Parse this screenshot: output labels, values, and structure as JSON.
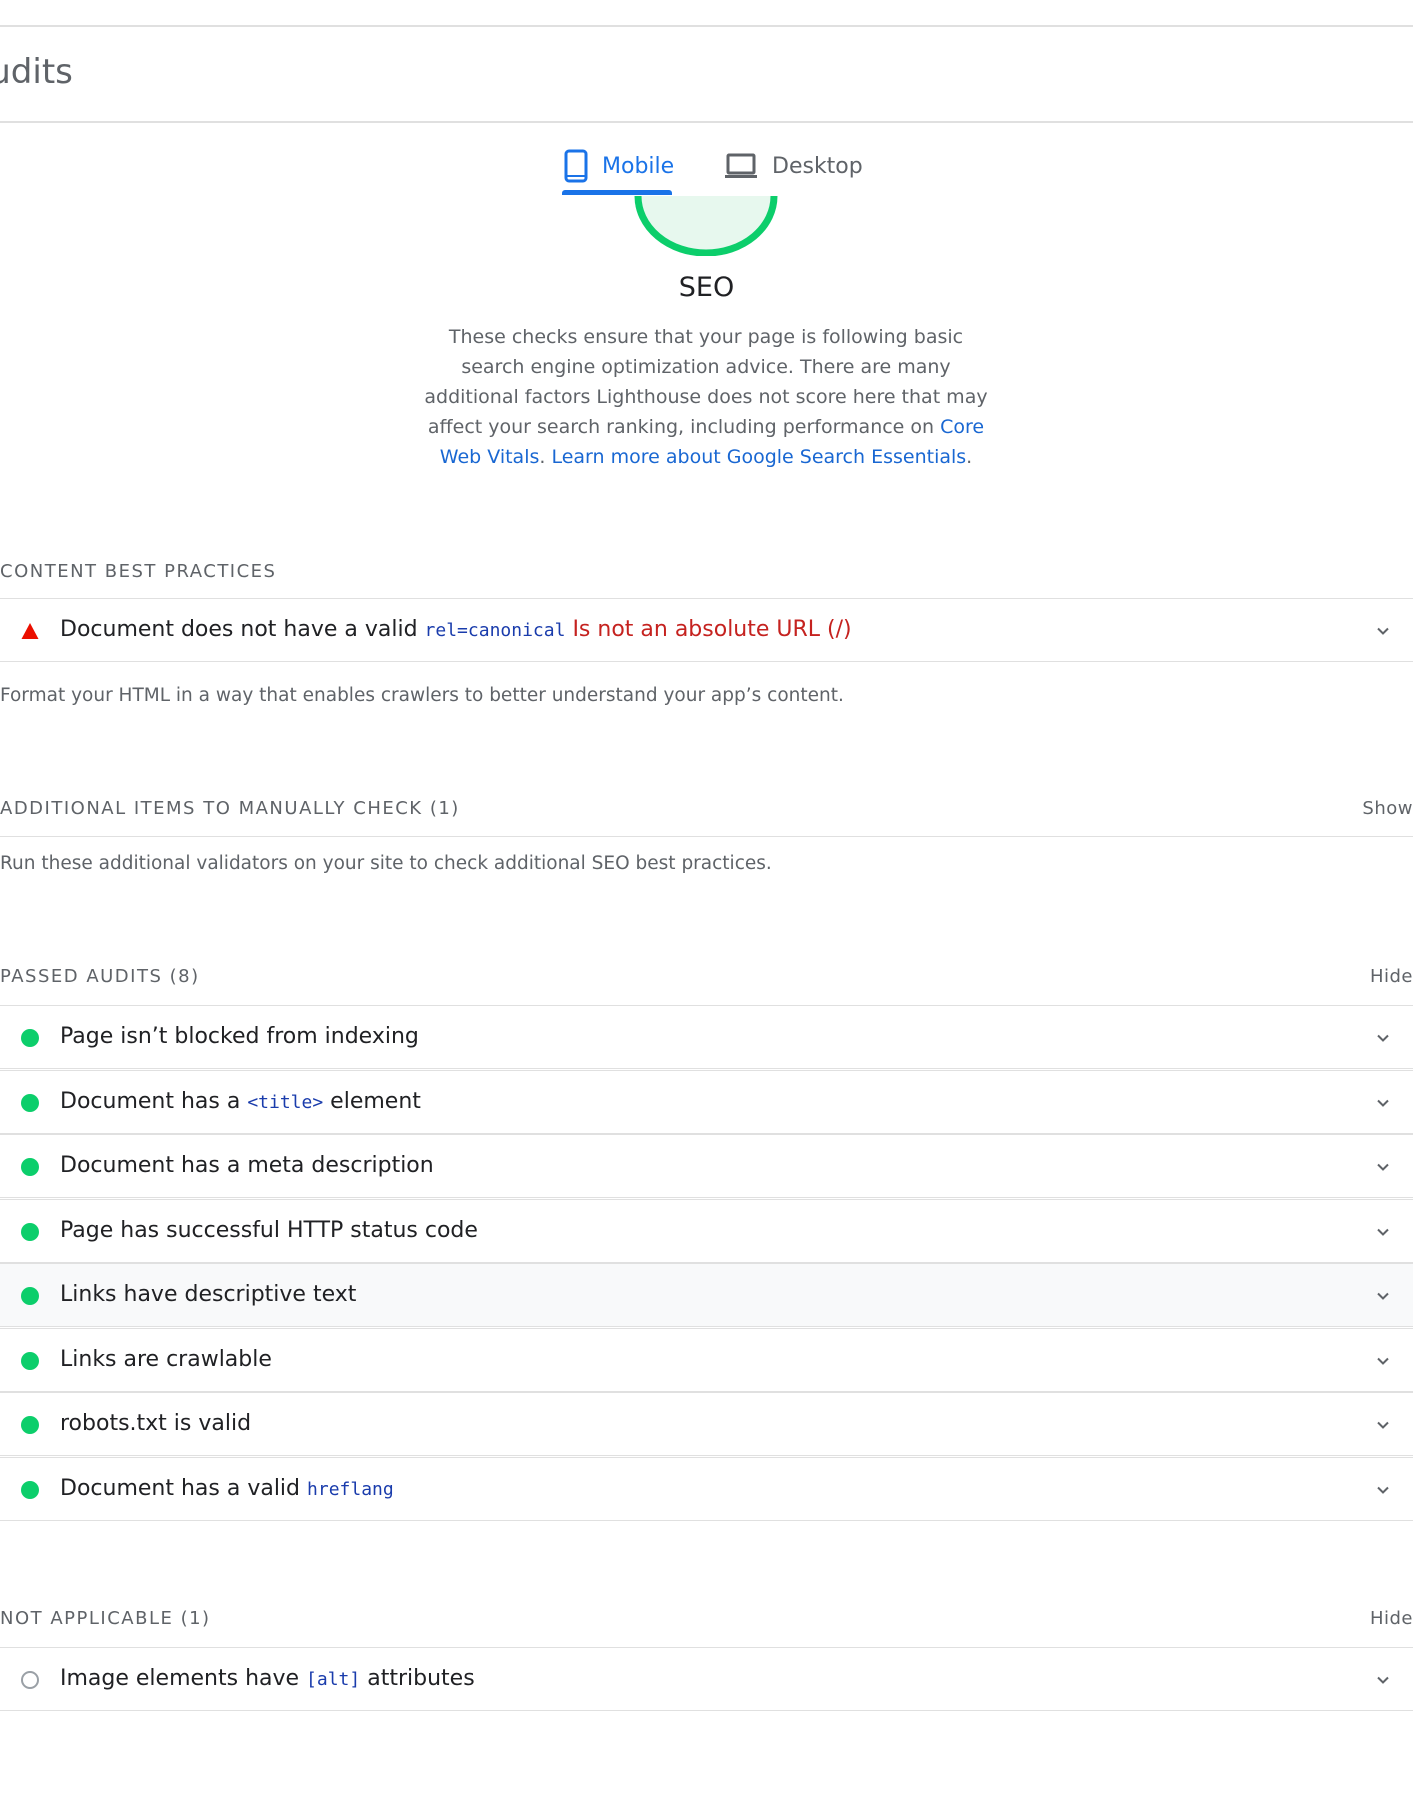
{
  "header": {
    "title": "Audits"
  },
  "tabs": [
    {
      "label": "Mobile",
      "icon": "mobile-phone-icon",
      "selected": true
    },
    {
      "label": "Desktop",
      "icon": "laptop-icon",
      "selected": false
    }
  ],
  "category": {
    "title": "SEO",
    "description_part1": "These checks ensure that your page is following basic search engine optimization advice. There are many additional factors Lighthouse does not score here that may affect your search ranking, including performance on ",
    "link_vitals": "Core Web Vitals",
    "description_sep": ". ",
    "link_learn": "Learn more about Google Search Essentials",
    "description_end": ".",
    "gauge_color": "#0cce6b"
  },
  "content_best_practices": {
    "heading": "CONTENT BEST PRACTICES",
    "audit": {
      "title": "Document does not have a valid ",
      "code": "rel=canonical",
      "error": "Is not an absolute URL (/)"
    },
    "description": "Format your HTML in a way that enables crawlers to better understand your app’s content."
  },
  "manual": {
    "heading": "ADDITIONAL ITEMS TO MANUALLY CHECK (1)",
    "toggle": "Show",
    "description": "Run these additional validators on your site to check additional SEO best practices."
  },
  "passed": {
    "heading": "PASSED AUDITS (8)",
    "toggle": "Hide",
    "audits": [
      {
        "pre": "Page isn’t blocked from indexing",
        "code": "",
        "post": ""
      },
      {
        "pre": "Document has a ",
        "code": "<title>",
        "post": " element"
      },
      {
        "pre": "Document has a meta description",
        "code": "",
        "post": ""
      },
      {
        "pre": "Page has successful HTTP status code",
        "code": "",
        "post": ""
      },
      {
        "pre": "Links have descriptive text",
        "code": "",
        "post": ""
      },
      {
        "pre": "Links are crawlable",
        "code": "",
        "post": ""
      },
      {
        "pre": "robots.txt is valid",
        "code": "",
        "post": ""
      },
      {
        "pre": "Document has a valid ",
        "code": "hreflang",
        "post": ""
      }
    ]
  },
  "not_applicable": {
    "heading": "NOT APPLICABLE (1)",
    "toggle": "Hide",
    "audit": {
      "pre": "Image elements have ",
      "code": "[alt]",
      "post": " attributes"
    }
  },
  "colors": {
    "pass": "#0cce6b",
    "fail": "#eb0f00",
    "accent": "#1a73e8",
    "link": "#1967d2"
  }
}
